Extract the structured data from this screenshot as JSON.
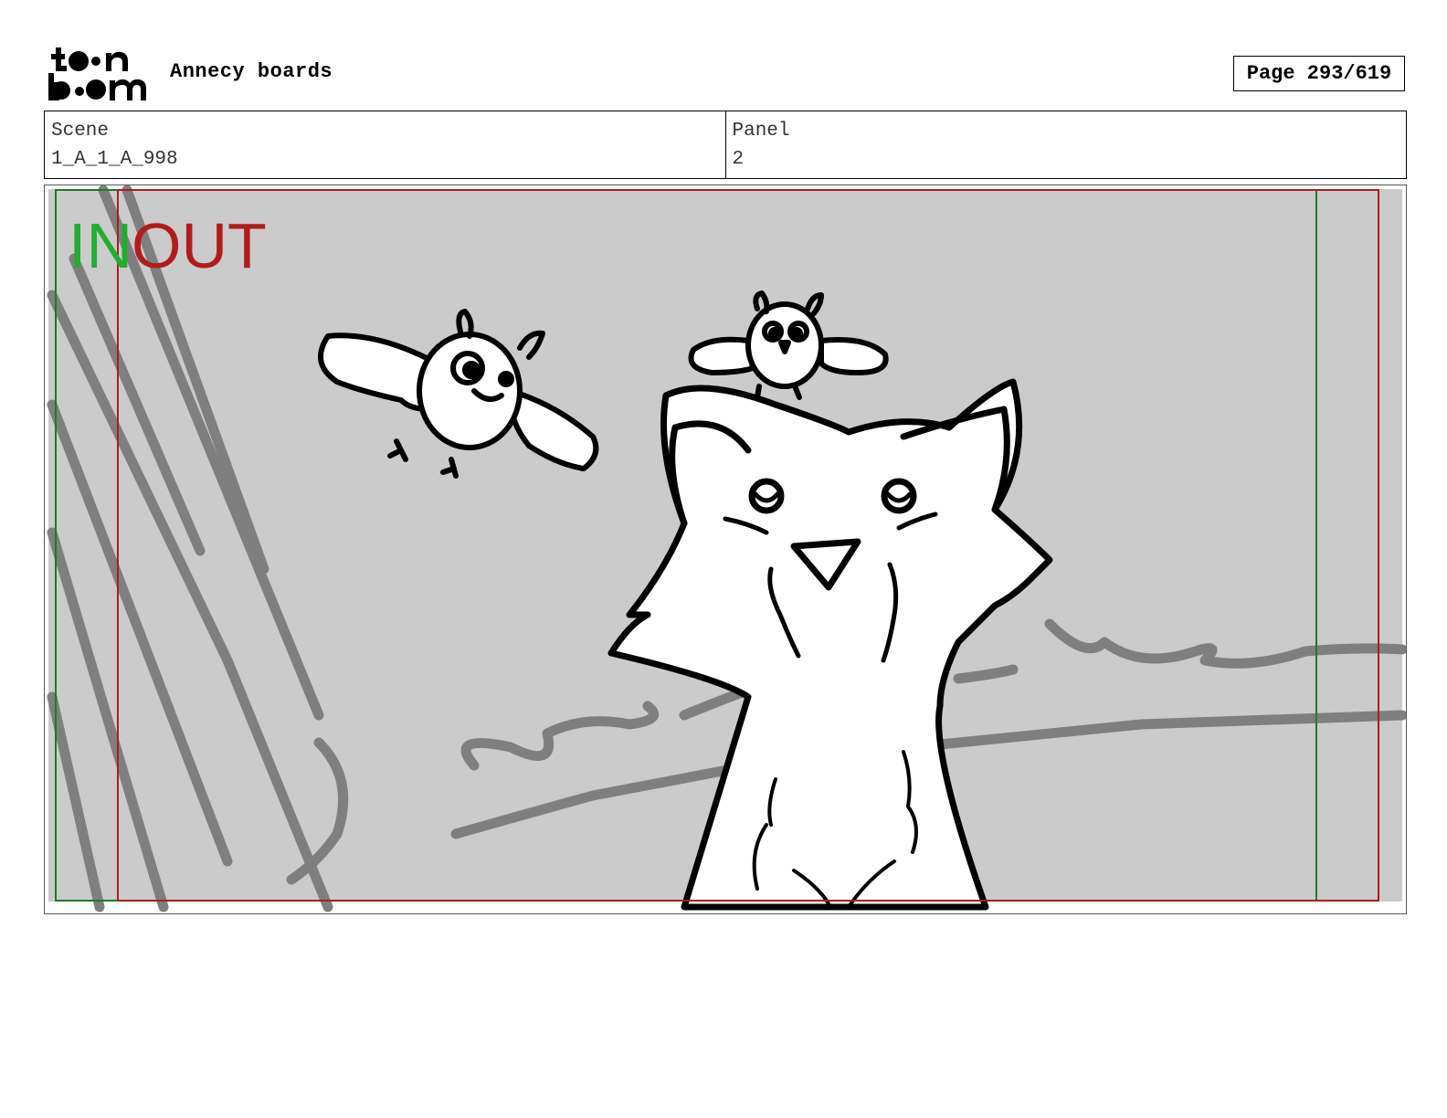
{
  "header": {
    "logo_text": "toon boom",
    "title": "Annecy boards",
    "page_label": "Page 293/619"
  },
  "info": {
    "scene_label": "Scene",
    "scene_value": "1_A_1_A_998",
    "panel_label": "Panel",
    "panel_value": "2"
  },
  "frame": {
    "in_label": "IN",
    "out_label": "OUT",
    "in_color": "#1fae2e",
    "out_color": "#b01c1c"
  }
}
